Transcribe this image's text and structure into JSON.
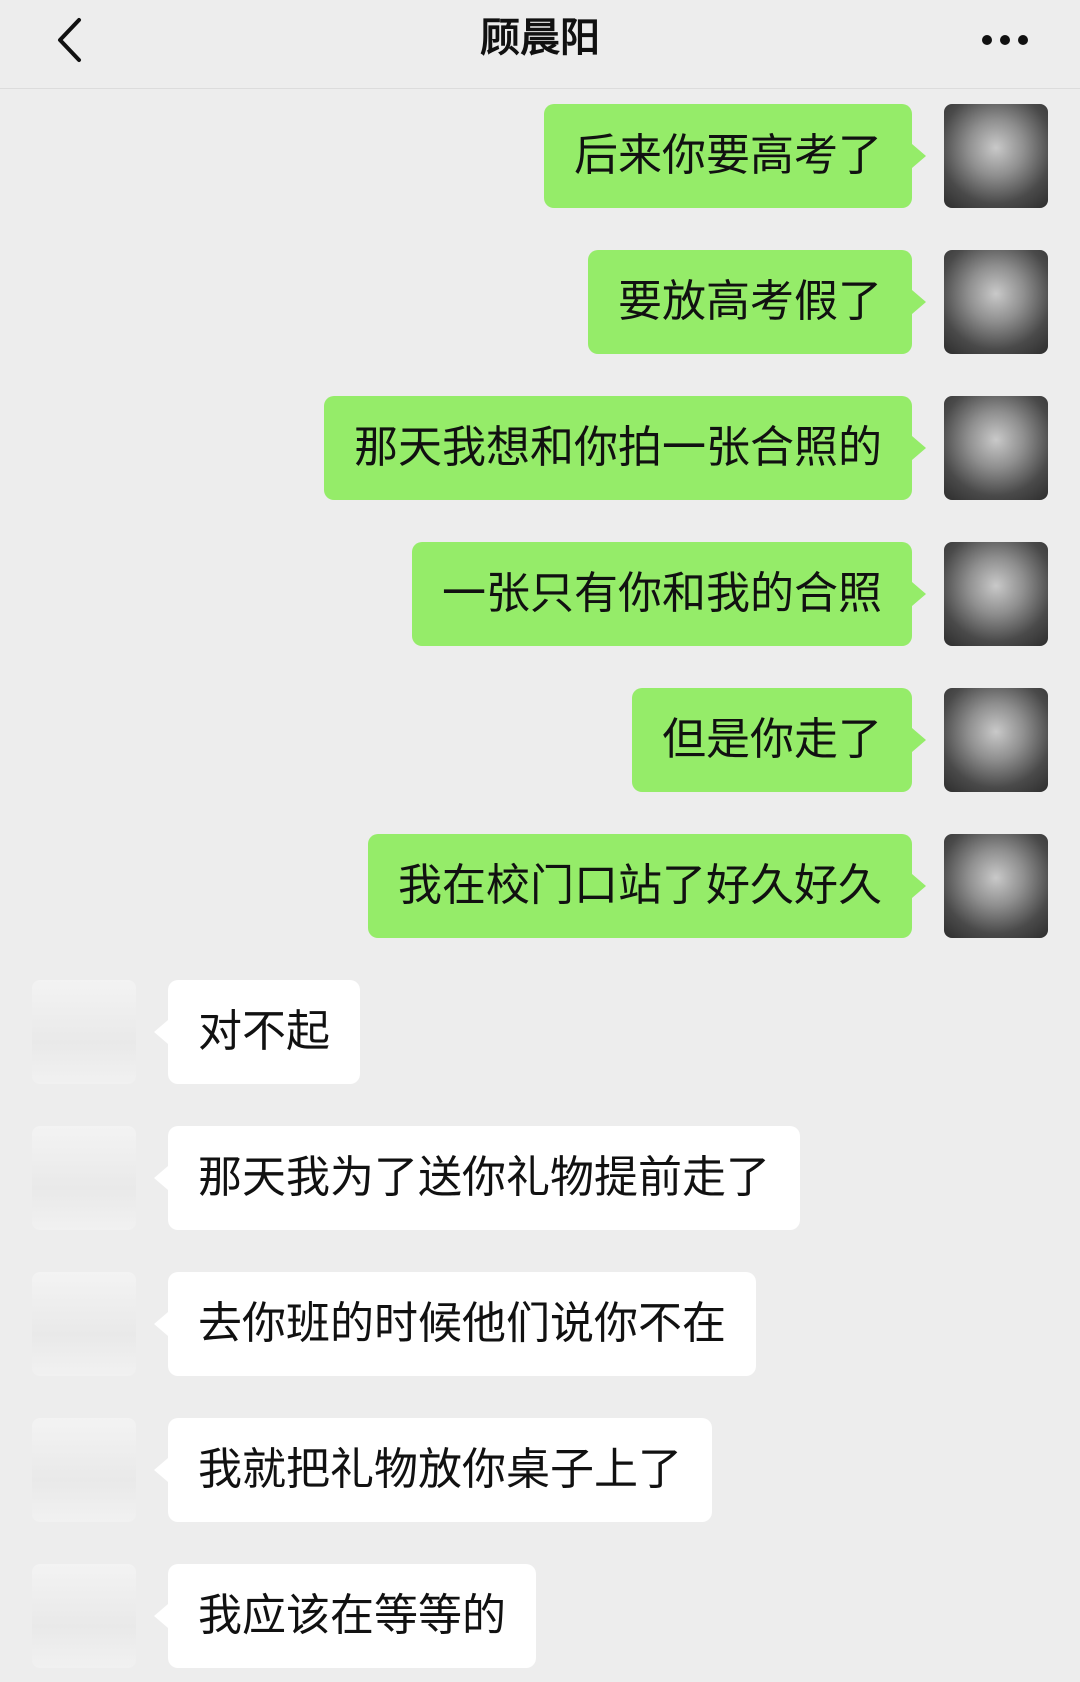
{
  "header": {
    "title": "顾晨阳",
    "back_icon": "chevron-left-icon",
    "more_icon": "more-dots-icon"
  },
  "messages": [
    {
      "direction": "sent",
      "text": "后来你要高考了"
    },
    {
      "direction": "sent",
      "text": "要放高考假了"
    },
    {
      "direction": "sent",
      "text": "那天我想和你拍一张合照的"
    },
    {
      "direction": "sent",
      "text": "一张只有你和我的合照"
    },
    {
      "direction": "sent",
      "text": "但是你走了"
    },
    {
      "direction": "sent",
      "text": "我在校门口站了好久好久"
    },
    {
      "direction": "received",
      "text": "对不起"
    },
    {
      "direction": "received",
      "text": "那天我为了送你礼物提前走了"
    },
    {
      "direction": "received",
      "text": "去你班的时候他们说你不在"
    },
    {
      "direction": "received",
      "text": "我就把礼物放你桌子上了"
    },
    {
      "direction": "received",
      "text": "我应该在等等的"
    }
  ],
  "colors": {
    "background": "#ededed",
    "sent_bubble": "#95ec69",
    "received_bubble": "#ffffff"
  }
}
